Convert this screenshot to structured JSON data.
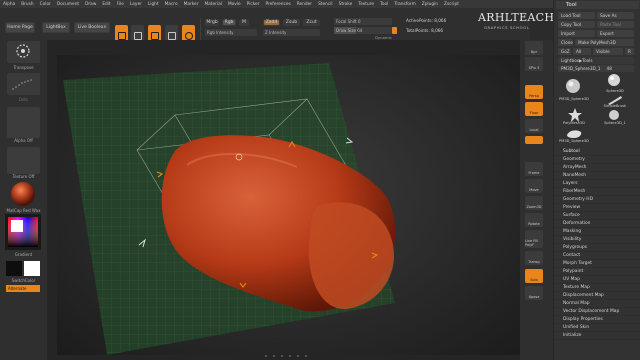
{
  "menu": [
    "Alpha",
    "Brush",
    "Color",
    "Document",
    "Draw",
    "Edit",
    "File",
    "Layer",
    "Light",
    "Macro",
    "Marker",
    "Material",
    "Movie",
    "Picker",
    "Preferences",
    "Render",
    "Stencil",
    "Stroke",
    "Texture",
    "Tool",
    "Transform",
    "Zplugin",
    "Zscript"
  ],
  "topbar": {
    "home_page": "Home Page",
    "lightbox": "LightBox",
    "live_boolean": "Live Boolean",
    "tools": [
      "Edit",
      "Draw",
      "Move",
      "Scale",
      "Rotate"
    ],
    "mrgb": "Mrgb",
    "rgb": "Rgb",
    "m": "M",
    "zadd": "Zadd",
    "zsub": "Zsub",
    "zcut": "Zcut",
    "rgb_intensity": "Rgb Intensity",
    "z_intensity": "Z Intensity",
    "focal_shift_label": "Focal Shift 0",
    "draw_size_label": "Draw Size 64",
    "active_points": "ActivePoints: 8,066",
    "total_points": "TotalPoints: 8,066",
    "dynamic": "Dynamic"
  },
  "watermark": {
    "title": "ARHLTEACH",
    "subtitle": "GRAPHICS SCHOOL"
  },
  "left_shelf": {
    "brush": "Transpose",
    "stroke": "Dots",
    "alpha": "Alpha Off",
    "texture": "Texture Off",
    "material": "MatCap Red Wax",
    "gradient": "Gradient",
    "switch_color": "SwitchColor",
    "alternate": "Alternate"
  },
  "right_shelf": [
    "Bpr",
    "SPix 3",
    "Persp",
    "Floor",
    "Local",
    "",
    "Frame",
    "Move",
    "Zoom3D",
    "Rotate",
    "Line Fill PolyF",
    "Transp",
    "Solo",
    "Xpose"
  ],
  "palette": {
    "title": "Tool",
    "load_tool": "Load Tool",
    "save_as": "Save As",
    "copy_tool": "Copy Tool",
    "paste_tool": "Paste Tool",
    "import": "Import",
    "export": "Export",
    "clone": "Clone",
    "make_polymesh": "Make PolyMesh3D",
    "goz": "GoZ",
    "all": "All",
    "visible": "Visible",
    "r": "R",
    "lightbox_tools": "Lightbox▶Tools",
    "current_tool": "PM3D_Sphere3D_1",
    "current_value": "48",
    "thumbs": [
      "PM3D_Sphere3D",
      "Sphere3D",
      "SimpleBrush",
      "PolyMesh3D",
      "Sphere3D_1",
      "PM3D_Sphere3D"
    ],
    "subpalettes": [
      "Subtool",
      "Geometry",
      "ArrayMesh",
      "NanoMesh",
      "Layers",
      "FiberMesh",
      "Geometry HD",
      "Preview",
      "Surface",
      "Deformation",
      "Masking",
      "Visibility",
      "Polygroups",
      "Contact",
      "Morph Target",
      "Polypaint",
      "UV Map",
      "Texture Map",
      "Displacement Map",
      "Normal Map",
      "Vector Displacement Map",
      "Display Properties",
      "Unified Skin",
      "Initialize"
    ]
  },
  "colors": {
    "accent": "#e8861c",
    "mesh": "#c4471f",
    "canvas": "#2a2a2a"
  }
}
